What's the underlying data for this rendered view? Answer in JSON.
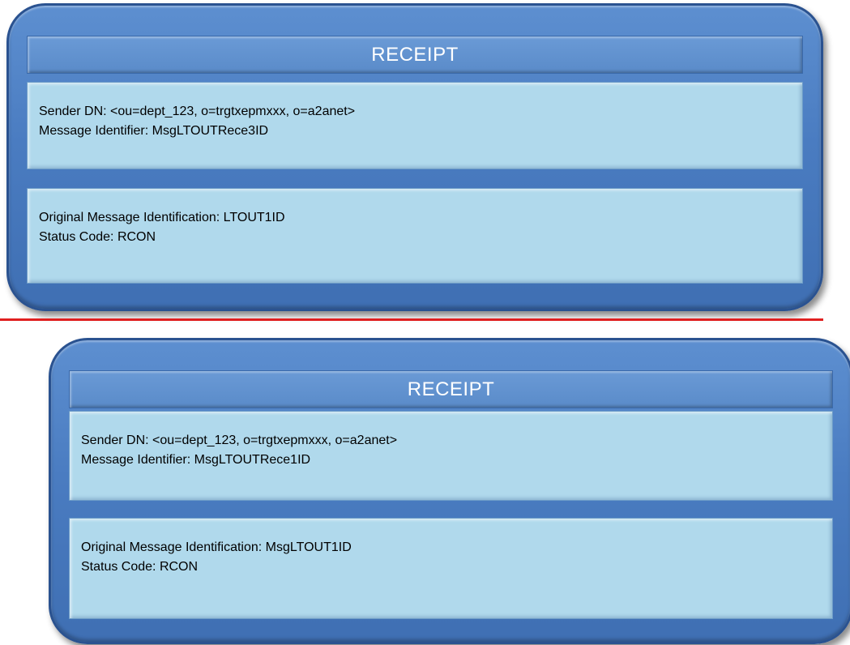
{
  "receipts": [
    {
      "title": "RECEIPT",
      "sender_dn": "Sender DN: <ou=dept_123, o=trgtxepmxxx, o=a2anet>",
      "message_identifier": "Message Identifier: MsgLTOUTRece3ID",
      "original_message_identification": "Original Message Identification: LTOUT1ID",
      "status_code": "Status Code: RCON"
    },
    {
      "title": "RECEIPT",
      "sender_dn": "Sender DN: <ou=dept_123, o=trgtxepmxxx, o=a2anet>",
      "message_identifier": "Message Identifier: MsgLTOUTRece1ID",
      "original_message_identification": "Original Message Identification: MsgLTOUT1ID",
      "status_code": "Status Code: RCON"
    }
  ],
  "colors": {
    "card_fill": "#4a7cc1",
    "panel_fill": "#b0d9ec",
    "divider": "#e02020",
    "title_text": "#ffffff"
  }
}
